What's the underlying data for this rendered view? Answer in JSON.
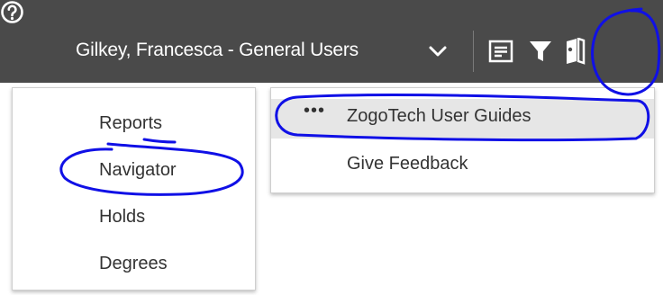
{
  "header": {
    "user_label": "Gilkey, Francesca - General Users",
    "icons": [
      "chevron-down-icon",
      "reports-icon",
      "filter-icon",
      "book-icon",
      "help-icon"
    ],
    "background": "#4a4a4a"
  },
  "nav_menu": {
    "items": [
      {
        "label": "Reports"
      },
      {
        "label": "Navigator"
      },
      {
        "label": "Holds"
      },
      {
        "label": "Degrees"
      }
    ]
  },
  "help_menu": {
    "items": [
      {
        "label": "ZogoTech User Guides",
        "prefix": "•••"
      },
      {
        "label": "Give Feedback"
      }
    ]
  },
  "annotation_color": "#1010e6"
}
